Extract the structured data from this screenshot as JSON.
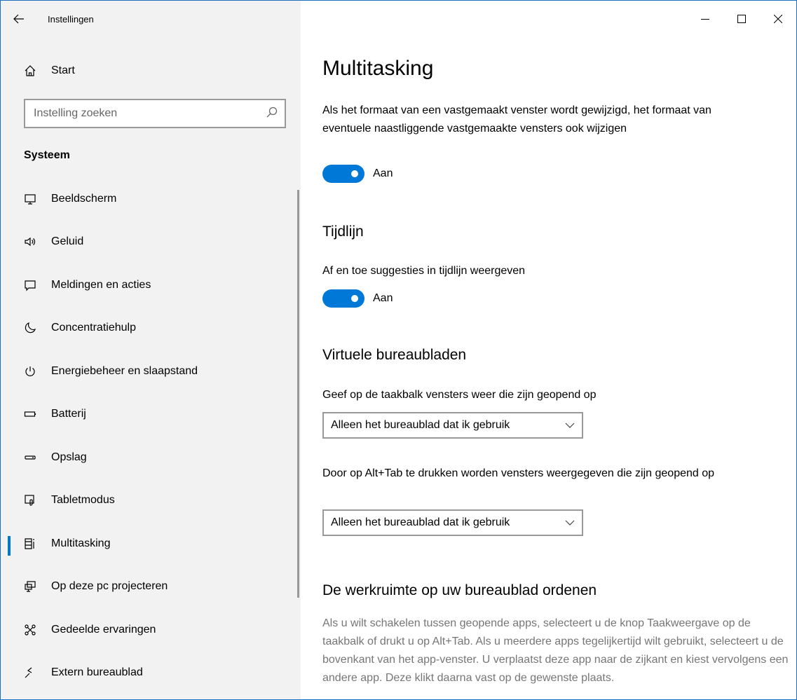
{
  "window": {
    "title": "Instellingen"
  },
  "sidebar": {
    "home_label": "Start",
    "search_placeholder": "Instelling zoeken",
    "section_heading": "Systeem",
    "items": [
      {
        "label": "Beeldscherm",
        "icon": "monitor-icon"
      },
      {
        "label": "Geluid",
        "icon": "speaker-icon"
      },
      {
        "label": "Meldingen en acties",
        "icon": "notification-icon"
      },
      {
        "label": "Concentratiehulp",
        "icon": "moon-icon"
      },
      {
        "label": "Energiebeheer en slaapstand",
        "icon": "power-icon"
      },
      {
        "label": "Batterij",
        "icon": "battery-icon"
      },
      {
        "label": "Opslag",
        "icon": "storage-icon"
      },
      {
        "label": "Tabletmodus",
        "icon": "tablet-mode-icon"
      },
      {
        "label": "Multitasking",
        "icon": "multitasking-icon",
        "selected": true
      },
      {
        "label": "Op deze pc projecteren",
        "icon": "project-icon"
      },
      {
        "label": "Gedeelde ervaringen",
        "icon": "shared-experiences-icon"
      },
      {
        "label": "Extern bureaublad",
        "icon": "remote-desktop-icon"
      }
    ]
  },
  "content": {
    "title": "Multitasking",
    "snap_description": "Als het formaat van een vastgemaakt venster wordt gewijzigd, het formaat van eventuele naastliggende vastgemaakte vensters ook wijzigen",
    "snap_toggle_state": "Aan",
    "timeline_heading": "Tijdlijn",
    "timeline_description": "Af en toe suggesties in tijdlijn weergeven",
    "timeline_toggle_state": "Aan",
    "virtual_desktops_heading": "Virtuele bureaubladen",
    "taskbar_description": "Geef op de taakbalk vensters weer die zijn geopend op",
    "taskbar_dropdown_value": "Alleen het bureaublad dat ik gebruik",
    "alttab_description": "Door op Alt+Tab te drukken worden vensters weergegeven die zijn geopend op",
    "alttab_dropdown_value": "Alleen het bureaublad dat ik gebruik",
    "workspace_heading": "De werkruimte op uw bureaublad ordenen",
    "workspace_description": "Als u wilt schakelen tussen geopende apps, selecteert u de knop Taakweergave op de taakbalk of drukt u op Alt+Tab. Als u meerdere apps tegelijkertijd wilt gebruikt, selecteert u de bovenkant van het app-venster. U verplaatst deze app naar de zijkant en kiest vervolgens een andere app. Deze klikt daarna vast op de gewenste plaats."
  },
  "colors": {
    "accent": "#0078d7",
    "sidebar_bg": "#f2f2f2",
    "muted_text": "#767676"
  }
}
